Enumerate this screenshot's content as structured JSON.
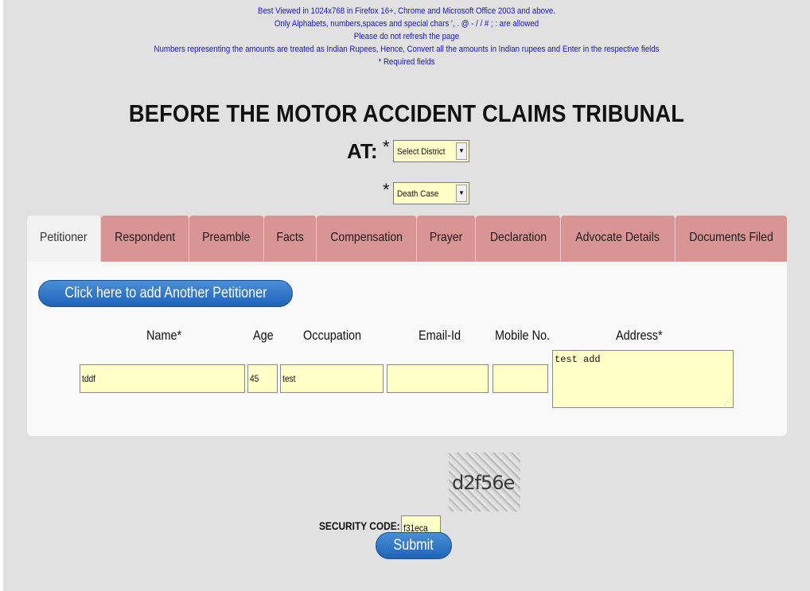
{
  "notices": [
    "Best Viewed in 1024x768 in Firefox 16+, Chrome and Microsoft Office 2003 and above.",
    "Only Alphabets, numbers,spaces and special chars ', . @ - / / # ; : are allowed",
    "Please do not refresh the page",
    "Numbers representing the amounts are treated as Indian Rupees, Hence, Convert all the amounts in Indian rupees and Enter in the respective fields",
    "* Required fields"
  ],
  "title": "BEFORE THE MOTOR ACCIDENT CLAIMS TRIBUNAL",
  "at_label": "AT:",
  "required_star": "*",
  "district_select": {
    "value": "Select District",
    "arrow": "▼"
  },
  "case_select": {
    "value": "Death Case",
    "arrow": "▼"
  },
  "tabs": [
    {
      "label": "Petitioner",
      "active": true
    },
    {
      "label": "Respondent",
      "active": false
    },
    {
      "label": "Preamble",
      "active": false
    },
    {
      "label": "Facts",
      "active": false
    },
    {
      "label": "Compensation",
      "active": false
    },
    {
      "label": "Prayer",
      "active": false
    },
    {
      "label": "Declaration",
      "active": false
    },
    {
      "label": "Advocate Details",
      "active": false
    },
    {
      "label": "Documents Filed",
      "active": false
    }
  ],
  "petitioner": {
    "add_button": "Click here to add Another Petitioner",
    "columns": {
      "name": "Name*",
      "age": "Age",
      "occupation": "Occupation",
      "email": "Email-Id",
      "mobile": "Mobile No.",
      "address": "Address*"
    },
    "values": {
      "name": "tddf",
      "age": "45",
      "occupation": "test",
      "email": "",
      "mobile": "",
      "address": "test add"
    }
  },
  "security": {
    "label": "SECURITY CODE:",
    "input_value": "f31eca",
    "captcha_text": "d2f56e"
  },
  "submit_label": "Submit",
  "colors": {
    "notice_text": "#1515cf",
    "tab_bg": "#d99494",
    "active_tab_bg": "#f2f2f2",
    "input_bg": "#ffffc8",
    "button_bg": "#2a72c4"
  }
}
